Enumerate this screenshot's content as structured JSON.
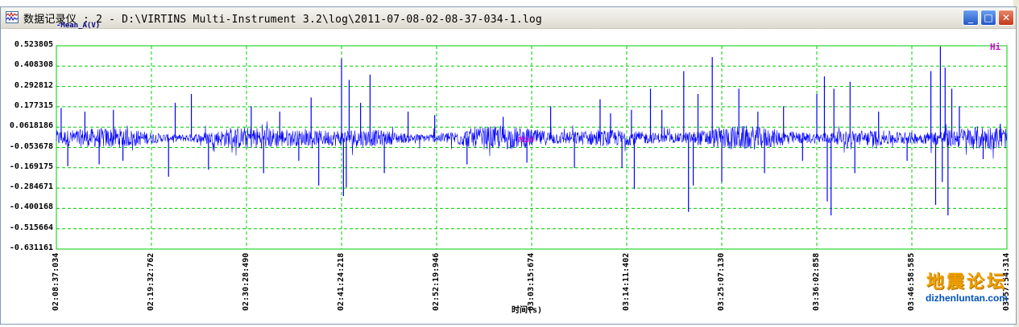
{
  "window": {
    "title": "数据记录仪 : 2 - D:\\VIRTINS Multi-Instrument 3.2\\log\\2011-07-08-02-08-37-034-1.log",
    "buttons": {
      "minimize": "_",
      "maximize": "□",
      "close": "✕"
    }
  },
  "icons": {
    "app": "waveform-app-icon",
    "minimize": "minimize-icon",
    "maximize": "maximize-icon",
    "close": "close-icon"
  },
  "colors": {
    "signal": "#0000ff",
    "grid": "#00cc00",
    "marker": "#d000d0"
  },
  "markers": {
    "hi": "Hi",
    "mid": "Mid"
  },
  "watermark": {
    "cn": "地震论坛",
    "url": "dizhenluntan.com"
  },
  "chart_data": {
    "type": "line",
    "legend": "Mean_A(V)",
    "xlabel": "时间(s)",
    "ylim": [
      -0.631161,
      0.523805
    ],
    "y_ticks": [
      "0.523805",
      "0.408308",
      "0.292812",
      "0.177315",
      "0.0618186",
      "-0.053678",
      "-0.169175",
      "-0.284671",
      "-0.400168",
      "-0.515664",
      "-0.631161"
    ],
    "x_ticks": [
      "02:08:37:034",
      "02:19:32:762",
      "02:30:28:490",
      "02:41:24:218",
      "02:52:19:946",
      "03:03:15:674",
      "03:14:11:402",
      "03:25:07:130",
      "03:36:02:858",
      "03:46:58:585",
      "03:57:54:314"
    ],
    "grid": true,
    "spikes": [
      {
        "t": 0.005,
        "v": 0.17
      },
      {
        "t": 0.012,
        "v": -0.16
      },
      {
        "t": 0.03,
        "v": 0.15
      },
      {
        "t": 0.045,
        "v": -0.15
      },
      {
        "t": 0.06,
        "v": 0.16
      },
      {
        "t": 0.07,
        "v": -0.13
      },
      {
        "t": 0.118,
        "v": -0.22
      },
      {
        "t": 0.125,
        "v": 0.2
      },
      {
        "t": 0.142,
        "v": 0.25
      },
      {
        "t": 0.16,
        "v": -0.18
      },
      {
        "t": 0.205,
        "v": 0.18
      },
      {
        "t": 0.218,
        "v": -0.2
      },
      {
        "t": 0.235,
        "v": 0.15
      },
      {
        "t": 0.255,
        "v": -0.13
      },
      {
        "t": 0.268,
        "v": 0.23
      },
      {
        "t": 0.276,
        "v": -0.27
      },
      {
        "t": 0.3,
        "v": 0.45
      },
      {
        "t": 0.302,
        "v": -0.33
      },
      {
        "t": 0.305,
        "v": -0.28
      },
      {
        "t": 0.308,
        "v": 0.33
      },
      {
        "t": 0.32,
        "v": 0.2
      },
      {
        "t": 0.33,
        "v": 0.36
      },
      {
        "t": 0.345,
        "v": -0.2
      },
      {
        "t": 0.37,
        "v": 0.15
      },
      {
        "t": 0.398,
        "v": 0.13
      },
      {
        "t": 0.432,
        "v": -0.15
      },
      {
        "t": 0.47,
        "v": 0.12
      },
      {
        "t": 0.495,
        "v": -0.14
      },
      {
        "t": 0.52,
        "v": 0.18
      },
      {
        "t": 0.545,
        "v": -0.17
      },
      {
        "t": 0.572,
        "v": 0.22
      },
      {
        "t": 0.583,
        "v": 0.14
      },
      {
        "t": 0.595,
        "v": -0.17
      },
      {
        "t": 0.605,
        "v": 0.16
      },
      {
        "t": 0.608,
        "v": -0.29
      },
      {
        "t": 0.625,
        "v": 0.28
      },
      {
        "t": 0.637,
        "v": 0.16
      },
      {
        "t": 0.66,
        "v": 0.38
      },
      {
        "t": 0.665,
        "v": -0.42
      },
      {
        "t": 0.67,
        "v": -0.27
      },
      {
        "t": 0.675,
        "v": 0.25
      },
      {
        "t": 0.69,
        "v": 0.46
      },
      {
        "t": 0.7,
        "v": -0.25
      },
      {
        "t": 0.718,
        "v": 0.28
      },
      {
        "t": 0.738,
        "v": 0.15
      },
      {
        "t": 0.745,
        "v": -0.2
      },
      {
        "t": 0.765,
        "v": 0.18
      },
      {
        "t": 0.785,
        "v": -0.13
      },
      {
        "t": 0.8,
        "v": 0.25
      },
      {
        "t": 0.808,
        "v": 0.35
      },
      {
        "t": 0.811,
        "v": -0.36
      },
      {
        "t": 0.815,
        "v": -0.44
      },
      {
        "t": 0.818,
        "v": 0.28
      },
      {
        "t": 0.835,
        "v": 0.32
      },
      {
        "t": 0.84,
        "v": -0.2
      },
      {
        "t": 0.865,
        "v": 0.15
      },
      {
        "t": 0.895,
        "v": -0.13
      },
      {
        "t": 0.92,
        "v": 0.38
      },
      {
        "t": 0.925,
        "v": -0.38
      },
      {
        "t": 0.93,
        "v": 0.52
      },
      {
        "t": 0.932,
        "v": -0.25
      },
      {
        "t": 0.935,
        "v": 0.4
      },
      {
        "t": 0.938,
        "v": -0.44
      },
      {
        "t": 0.942,
        "v": 0.28
      },
      {
        "t": 0.95,
        "v": 0.18
      },
      {
        "t": 0.975,
        "v": -0.12
      },
      {
        "t": 0.993,
        "v": 0.08
      }
    ]
  }
}
